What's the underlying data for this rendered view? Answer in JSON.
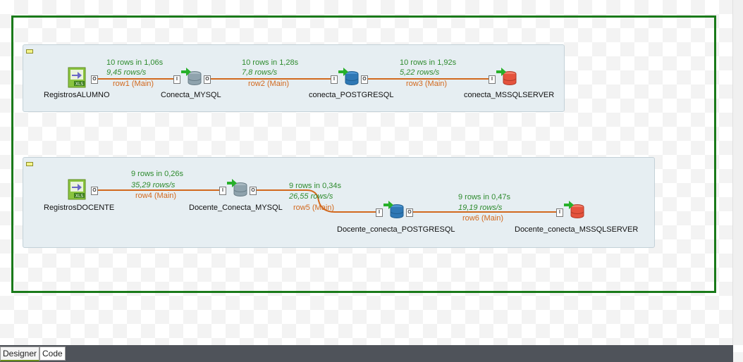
{
  "subjob1": {
    "components": {
      "c1": "RegistrosALUMNO",
      "c2": "Conecta_MYSQL",
      "c3": "conecta_POSTGRESQL",
      "c4": "conecta_MSSQLSERVER"
    },
    "flows": [
      {
        "rows": "10 rows in 1,06s",
        "rate": "9,45 rows/s",
        "label": "row1 (Main)"
      },
      {
        "rows": "10 rows in 1,28s",
        "rate": "7,8 rows/s",
        "label": "row2 (Main)"
      },
      {
        "rows": "10 rows in 1,92s",
        "rate": "5,22 rows/s",
        "label": "row3 (Main)"
      }
    ]
  },
  "subjob2": {
    "components": {
      "c1": "RegistrosDOCENTE",
      "c2": "Docente_Conecta_MYSQL",
      "c3": "Docente_conecta_POSTGRESQL",
      "c4": "Docente_conecta_MSSQLSERVER"
    },
    "flows": [
      {
        "rows": "9 rows in 0,26s",
        "rate": "35,29 rows/s",
        "label": "row4 (Main)"
      },
      {
        "rows": "9 rows in 0,34s",
        "rate": "26,55 rows/s",
        "label": "row5 (Main)"
      },
      {
        "rows": "9 rows in 0,47s",
        "rate": "19,19 rows/s",
        "label": "row6 (Main)"
      }
    ]
  },
  "connector": {
    "input": "I",
    "output": "O"
  },
  "icons": {
    "xls": "XLS",
    "xls_icon": "excel-file-icon",
    "db_icon": "database-icon"
  },
  "colors": {
    "frame": "#1a7a1a",
    "flow": "#d2691e",
    "stats": "#2e8b2e",
    "mysql": "#8fa3ad",
    "postgres": "#2f78b5",
    "mssql": "#e5533d"
  },
  "tabs": {
    "designer": "Designer",
    "code": "Code"
  }
}
